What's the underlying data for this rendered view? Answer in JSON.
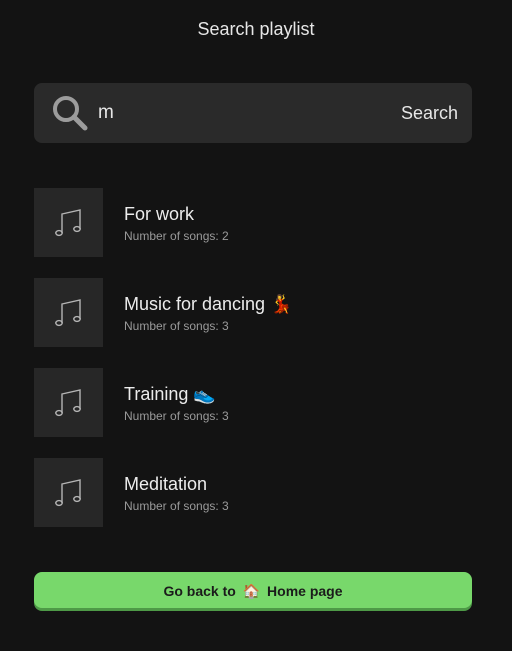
{
  "header": {
    "title": "Search playlist"
  },
  "search": {
    "value": "m",
    "button_label": "Search",
    "icon": "search-icon"
  },
  "playlists": [
    {
      "title": "For work",
      "songs": "Number of songs: 2",
      "icon": "music-note-icon"
    },
    {
      "title": "Music for dancing 💃",
      "songs": "Number of songs: 3",
      "icon": "music-note-icon"
    },
    {
      "title": "Training 👟",
      "songs": "Number of songs: 3",
      "icon": "music-note-icon"
    },
    {
      "title": "Meditation",
      "songs": "Number of songs: 3",
      "icon": "music-note-icon"
    }
  ],
  "footer": {
    "home_prefix": "Go back to",
    "home_icon": "🏠",
    "home_suffix": "Home page"
  },
  "colors": {
    "background": "#131313",
    "surface": "#2a2a2a",
    "accent": "#78d86b"
  }
}
